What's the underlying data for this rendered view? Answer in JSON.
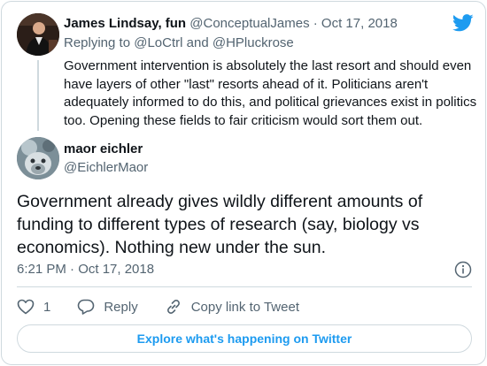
{
  "parent_tweet": {
    "author_name": "James Lindsay, fun",
    "handle": "@ConceptualJames",
    "separator": "·",
    "date": "Oct 17, 2018",
    "replying_prefix": "Replying to",
    "mention_1": "@LoCtrl",
    "and_word": "and",
    "mention_2": "@HPluckrose",
    "text": "Government intervention is absolutely the last resort and should even have layers of other \"last\" resorts ahead of it. Politicians aren't adequately informed to do this, and political grievances exist in politics too. Opening these fields to fair criticism would sort them out."
  },
  "main_tweet": {
    "author_name": "maor eichler",
    "handle": "@EichlerMaor",
    "text": "Government already gives wildly different amounts of funding to different types of research (say, biology vs economics). Nothing new under the sun.",
    "timestamp": "6:21 PM · Oct 17, 2018"
  },
  "actions": {
    "like_count": "1",
    "reply_label": "Reply",
    "copy_link_label": "Copy link to Tweet"
  },
  "explore_label": "Explore what's happening on Twitter",
  "colors": {
    "twitter_blue": "#1d9bf0",
    "muted_text": "#536471",
    "border": "#cfd9de"
  },
  "icons": [
    "twitter-bird-icon",
    "info-icon",
    "heart-icon",
    "reply-bubble-icon",
    "link-icon"
  ]
}
